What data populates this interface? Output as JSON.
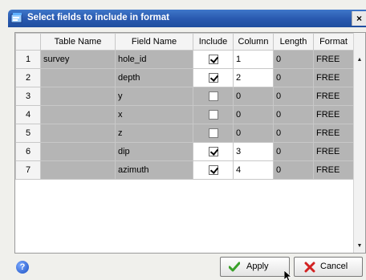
{
  "window": {
    "title": "Select fields to include in format",
    "close_glyph": "×"
  },
  "grid": {
    "columns": [
      "Table Name",
      "Field Name",
      "Include",
      "Column",
      "Length",
      "Format"
    ],
    "rows": [
      {
        "num": "1",
        "table_name": "survey",
        "field_name": "hole_id",
        "include": true,
        "column": "1",
        "length": "0",
        "format": "FREE"
      },
      {
        "num": "2",
        "table_name": "",
        "field_name": "depth",
        "include": true,
        "column": "2",
        "length": "0",
        "format": "FREE"
      },
      {
        "num": "3",
        "table_name": "",
        "field_name": "y",
        "include": false,
        "column": "0",
        "length": "0",
        "format": "FREE"
      },
      {
        "num": "4",
        "table_name": "",
        "field_name": "x",
        "include": false,
        "column": "0",
        "length": "0",
        "format": "FREE"
      },
      {
        "num": "5",
        "table_name": "",
        "field_name": "z",
        "include": false,
        "column": "0",
        "length": "0",
        "format": "FREE"
      },
      {
        "num": "6",
        "table_name": "",
        "field_name": "dip",
        "include": true,
        "column": "3",
        "length": "0",
        "format": "FREE"
      },
      {
        "num": "7",
        "table_name": "",
        "field_name": "azimuth",
        "include": true,
        "column": "4",
        "length": "0",
        "format": "FREE"
      }
    ]
  },
  "footer": {
    "help_glyph": "?",
    "apply_label": "Apply",
    "cancel_label": "Cancel"
  },
  "icons": {
    "window": "app-icon",
    "help": "help-icon",
    "apply": "checkmark-icon",
    "cancel": "red-x-icon",
    "scroll_up": "scroll-up-arrow-icon",
    "scroll_down": "scroll-down-arrow-icon"
  },
  "colors": {
    "title_bar": "#2a5ab0",
    "readonly_cell": "#b5b5b5",
    "apply_check": "#3aa12a",
    "cancel_x": "#d22222"
  }
}
